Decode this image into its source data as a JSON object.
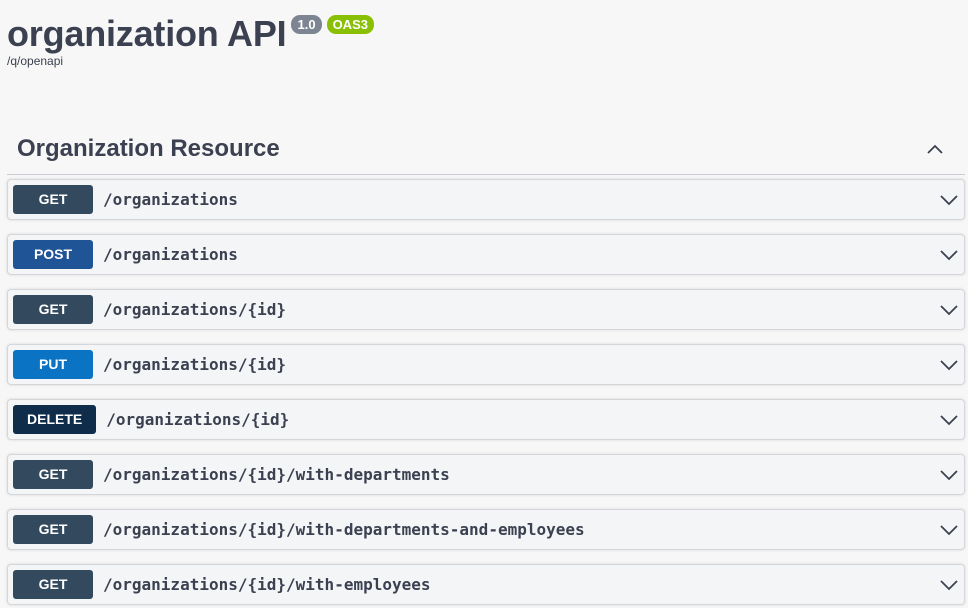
{
  "info": {
    "title": "organization API",
    "version": "1.0",
    "oas": "OAS3",
    "url": "/q/openapi"
  },
  "tag": {
    "name": "Organization Resource"
  },
  "colors": {
    "GET": "#334a5e",
    "POST": "#1f5496",
    "PUT": "#0a73c4",
    "DELETE": "#0f2c4b"
  },
  "operations": [
    {
      "method": "GET",
      "path": "/organizations"
    },
    {
      "method": "POST",
      "path": "/organizations"
    },
    {
      "method": "GET",
      "path": "/organizations/{id}"
    },
    {
      "method": "PUT",
      "path": "/organizations/{id}"
    },
    {
      "method": "DELETE",
      "path": "/organizations/{id}"
    },
    {
      "method": "GET",
      "path": "/organizations/{id}/with-departments"
    },
    {
      "method": "GET",
      "path": "/organizations/{id}/with-departments-and-employees"
    },
    {
      "method": "GET",
      "path": "/organizations/{id}/with-employees"
    }
  ]
}
